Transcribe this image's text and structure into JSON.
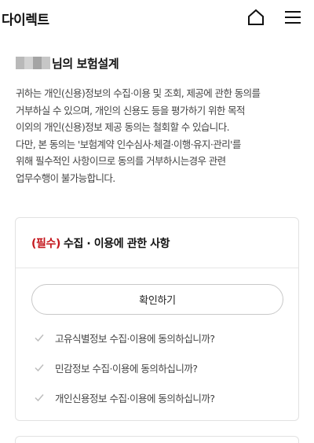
{
  "header": {
    "title": "다이렉트",
    "home_icon": "home-icon",
    "menu_icon": "hamburger-menu-icon"
  },
  "greeting": {
    "suffix": "님의 보험설계",
    "name_blur_colors": [
      "#b9b9b9",
      "#d2d2d2",
      "#a4a4a4",
      "#c6c6c6"
    ]
  },
  "notice": {
    "lines": [
      "귀하는 개인(신용)정보의 수집·이용 및 조회, 제공에 관한 동의를",
      "거부하실 수 있으며, 개인의 신용도 등을 평가하기 위한 목적",
      "이외의 개인(신용)정보 제공 동의는 철회할 수 있습니다.",
      "다만, 본 동의는 '보험계약 인수심사·체결·이행·유지·관리'를",
      "위해 필수적인 사항이므로 동의를 거부하시는경우 관련",
      "업무수행이 불가능합니다."
    ]
  },
  "consent_card": {
    "required_tag": "(필수)",
    "title": "수집 · 이용에 관한 사항",
    "confirm_button": "확인하기",
    "items": [
      "고유식별정보 수집·이용에 동의하십니까?",
      "민감정보 수집·이용에 동의하십니까?",
      "개인신용정보 수집·이용에 동의하십니까?"
    ]
  },
  "colors": {
    "required_red": "#c4161c",
    "border": "#e2e2e2",
    "check_gray": "#bdbdbd"
  }
}
